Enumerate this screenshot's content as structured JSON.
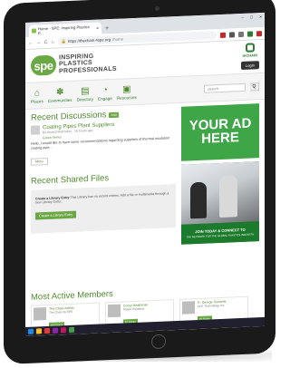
{
  "browser": {
    "tab_title": "Home - SPE: Inspiring Plastics P...",
    "new_tab": "+",
    "close_tab": "×",
    "url_host": "https://thechain.4spe.org",
    "url_path": "/home",
    "minimize": "–",
    "maximize": "□",
    "close": "×"
  },
  "site": {
    "logo": "spe",
    "tagline_1": "INSPIRING",
    "tagline_2": "PLASTICS",
    "tagline_3": "PROFESSIONALS",
    "chain_label": "thCHAIN",
    "login_label": "Login"
  },
  "nav": {
    "items": [
      {
        "label": "Places",
        "icon": "places-icon"
      },
      {
        "label": "Communities",
        "icon": "communities-icon"
      },
      {
        "label": "Directory",
        "icon": "directory-icon"
      },
      {
        "label": "Engage",
        "icon": "engage-icon"
      },
      {
        "label": "Resources",
        "icon": "resources-icon"
      }
    ],
    "search_placeholder": "search",
    "search_btn": "Q"
  },
  "discussions": {
    "title": "Recent Discussions",
    "add_label": "Add",
    "post_title": "Coating Pipes Plant Suppliers",
    "post_meta": "By Anatoli Mamedov · 16 hours ago",
    "post_group": "Green Series",
    "post_body": "Hello, I would like to have some recommendations regarding suppliers of thermal insulation coating pipe...",
    "more_label": "More"
  },
  "files": {
    "title": "Recent Shared Files",
    "empty_bold": "Create a Library Entry",
    "empty_text": "This Library has no recent entries. Add a file or multimedia through a new Library Entry.",
    "button_label": "Create a Library Entry"
  },
  "ads": {
    "ad1": "YOUR AD HERE",
    "ad2_caption": "JOIN TODAY & CONNECT TO",
    "ad2_sub": "THE NETWORK FOR THE GLOBAL PLASTICS INDUSTRY"
  },
  "members": {
    "title": "Most Active Members",
    "list": [
      {
        "name": "The Chain Admin",
        "company": "The Chain by SPE",
        "badge": "100 Points"
      },
      {
        "name": "Conor Heathman",
        "company": "Plastic Solutions",
        "badge": "87 Points"
      },
      {
        "name": "R. George Seesetle",
        "company": "ACE Technology, Inc.",
        "badge": "75 Points"
      }
    ]
  },
  "colors": {
    "brand_green": "#6aa843",
    "dark_green": "#2e7d32"
  }
}
